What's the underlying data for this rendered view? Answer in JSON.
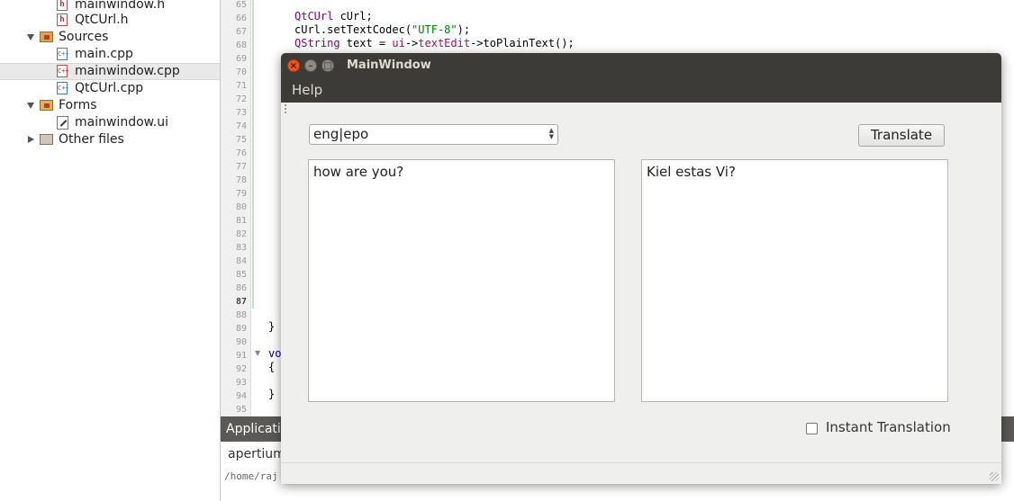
{
  "project_tree": {
    "items": [
      {
        "label": "mainwindow.h",
        "type": "header"
      },
      {
        "label": "QtCUrl.h",
        "type": "header"
      },
      {
        "label": "Sources",
        "type": "folder"
      },
      {
        "label": "main.cpp",
        "type": "source"
      },
      {
        "label": "mainwindow.cpp",
        "type": "source",
        "selected": true
      },
      {
        "label": "QtCUrl.cpp",
        "type": "source"
      },
      {
        "label": "Forms",
        "type": "folder"
      },
      {
        "label": "mainwindow.ui",
        "type": "form"
      },
      {
        "label": "Other files",
        "type": "folder"
      }
    ]
  },
  "editor": {
    "line_numbers": [
      "65",
      "66",
      "67",
      "68",
      "69",
      "70",
      "71",
      "72",
      "73",
      "74",
      "75",
      "76",
      "77",
      "78",
      "79",
      "80",
      "81",
      "82",
      "83",
      "84",
      "85",
      "86",
      "87",
      "88",
      "89",
      "90",
      "91",
      "92",
      "93",
      "94",
      "95"
    ],
    "current_line": "87",
    "code": {
      "l66_type": "QtCUrl",
      "l66_rest": " cUrl;",
      "l67_pre": "cUrl.setTextCodec(",
      "l67_str": "\"UTF-8\"",
      "l67_post": ");",
      "l68_type": "QString",
      "l68_mid": " text = ",
      "l68_var1": "ui",
      "l68_arrow1": "->",
      "l68_var2": "textEdit",
      "l68_rest": "->toPlainText();",
      "l89": "}",
      "l91": "vo",
      "l92": "{",
      "l94": "}"
    }
  },
  "app_output": {
    "title": "Applicati",
    "line1": "apertium",
    "line2": "/home/raj"
  },
  "main_window": {
    "title": "MainWindow",
    "menu": {
      "help": "Help"
    },
    "language_pair": "eng|epo",
    "translate_label": "Translate",
    "source_text": "how are you?",
    "translated_text": "Kiel estas Vi?",
    "instant_translation_label": "Instant Translation",
    "instant_translation_checked": false,
    "close_glyph": "×",
    "minimize_glyph": "–",
    "maximize_glyph": "□"
  },
  "icons": {
    "header_file": "h-file-icon",
    "source_file": "cpp-file-icon",
    "folder": "folder-icon",
    "form_file": "ui-form-icon"
  }
}
